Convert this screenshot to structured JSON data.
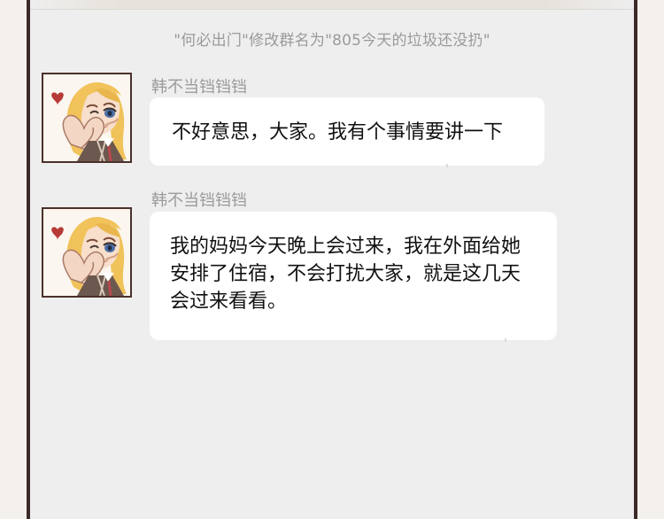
{
  "chat": {
    "system_notice": "\"何必出门\"修改群名为\"805今天的垃圾还没扔\"",
    "messages": [
      {
        "sender": "韩不当铛铛铛",
        "lines": [
          "不好意思，大家。我有个事情要讲一下"
        ]
      },
      {
        "sender": "韩不当铛铛铛",
        "lines": [
          "我的妈妈今天晚上会过来，我在外面给她",
          "安排了住宿，不会打扰大家，就是这几天",
          "会过来看看。"
        ]
      }
    ]
  }
}
